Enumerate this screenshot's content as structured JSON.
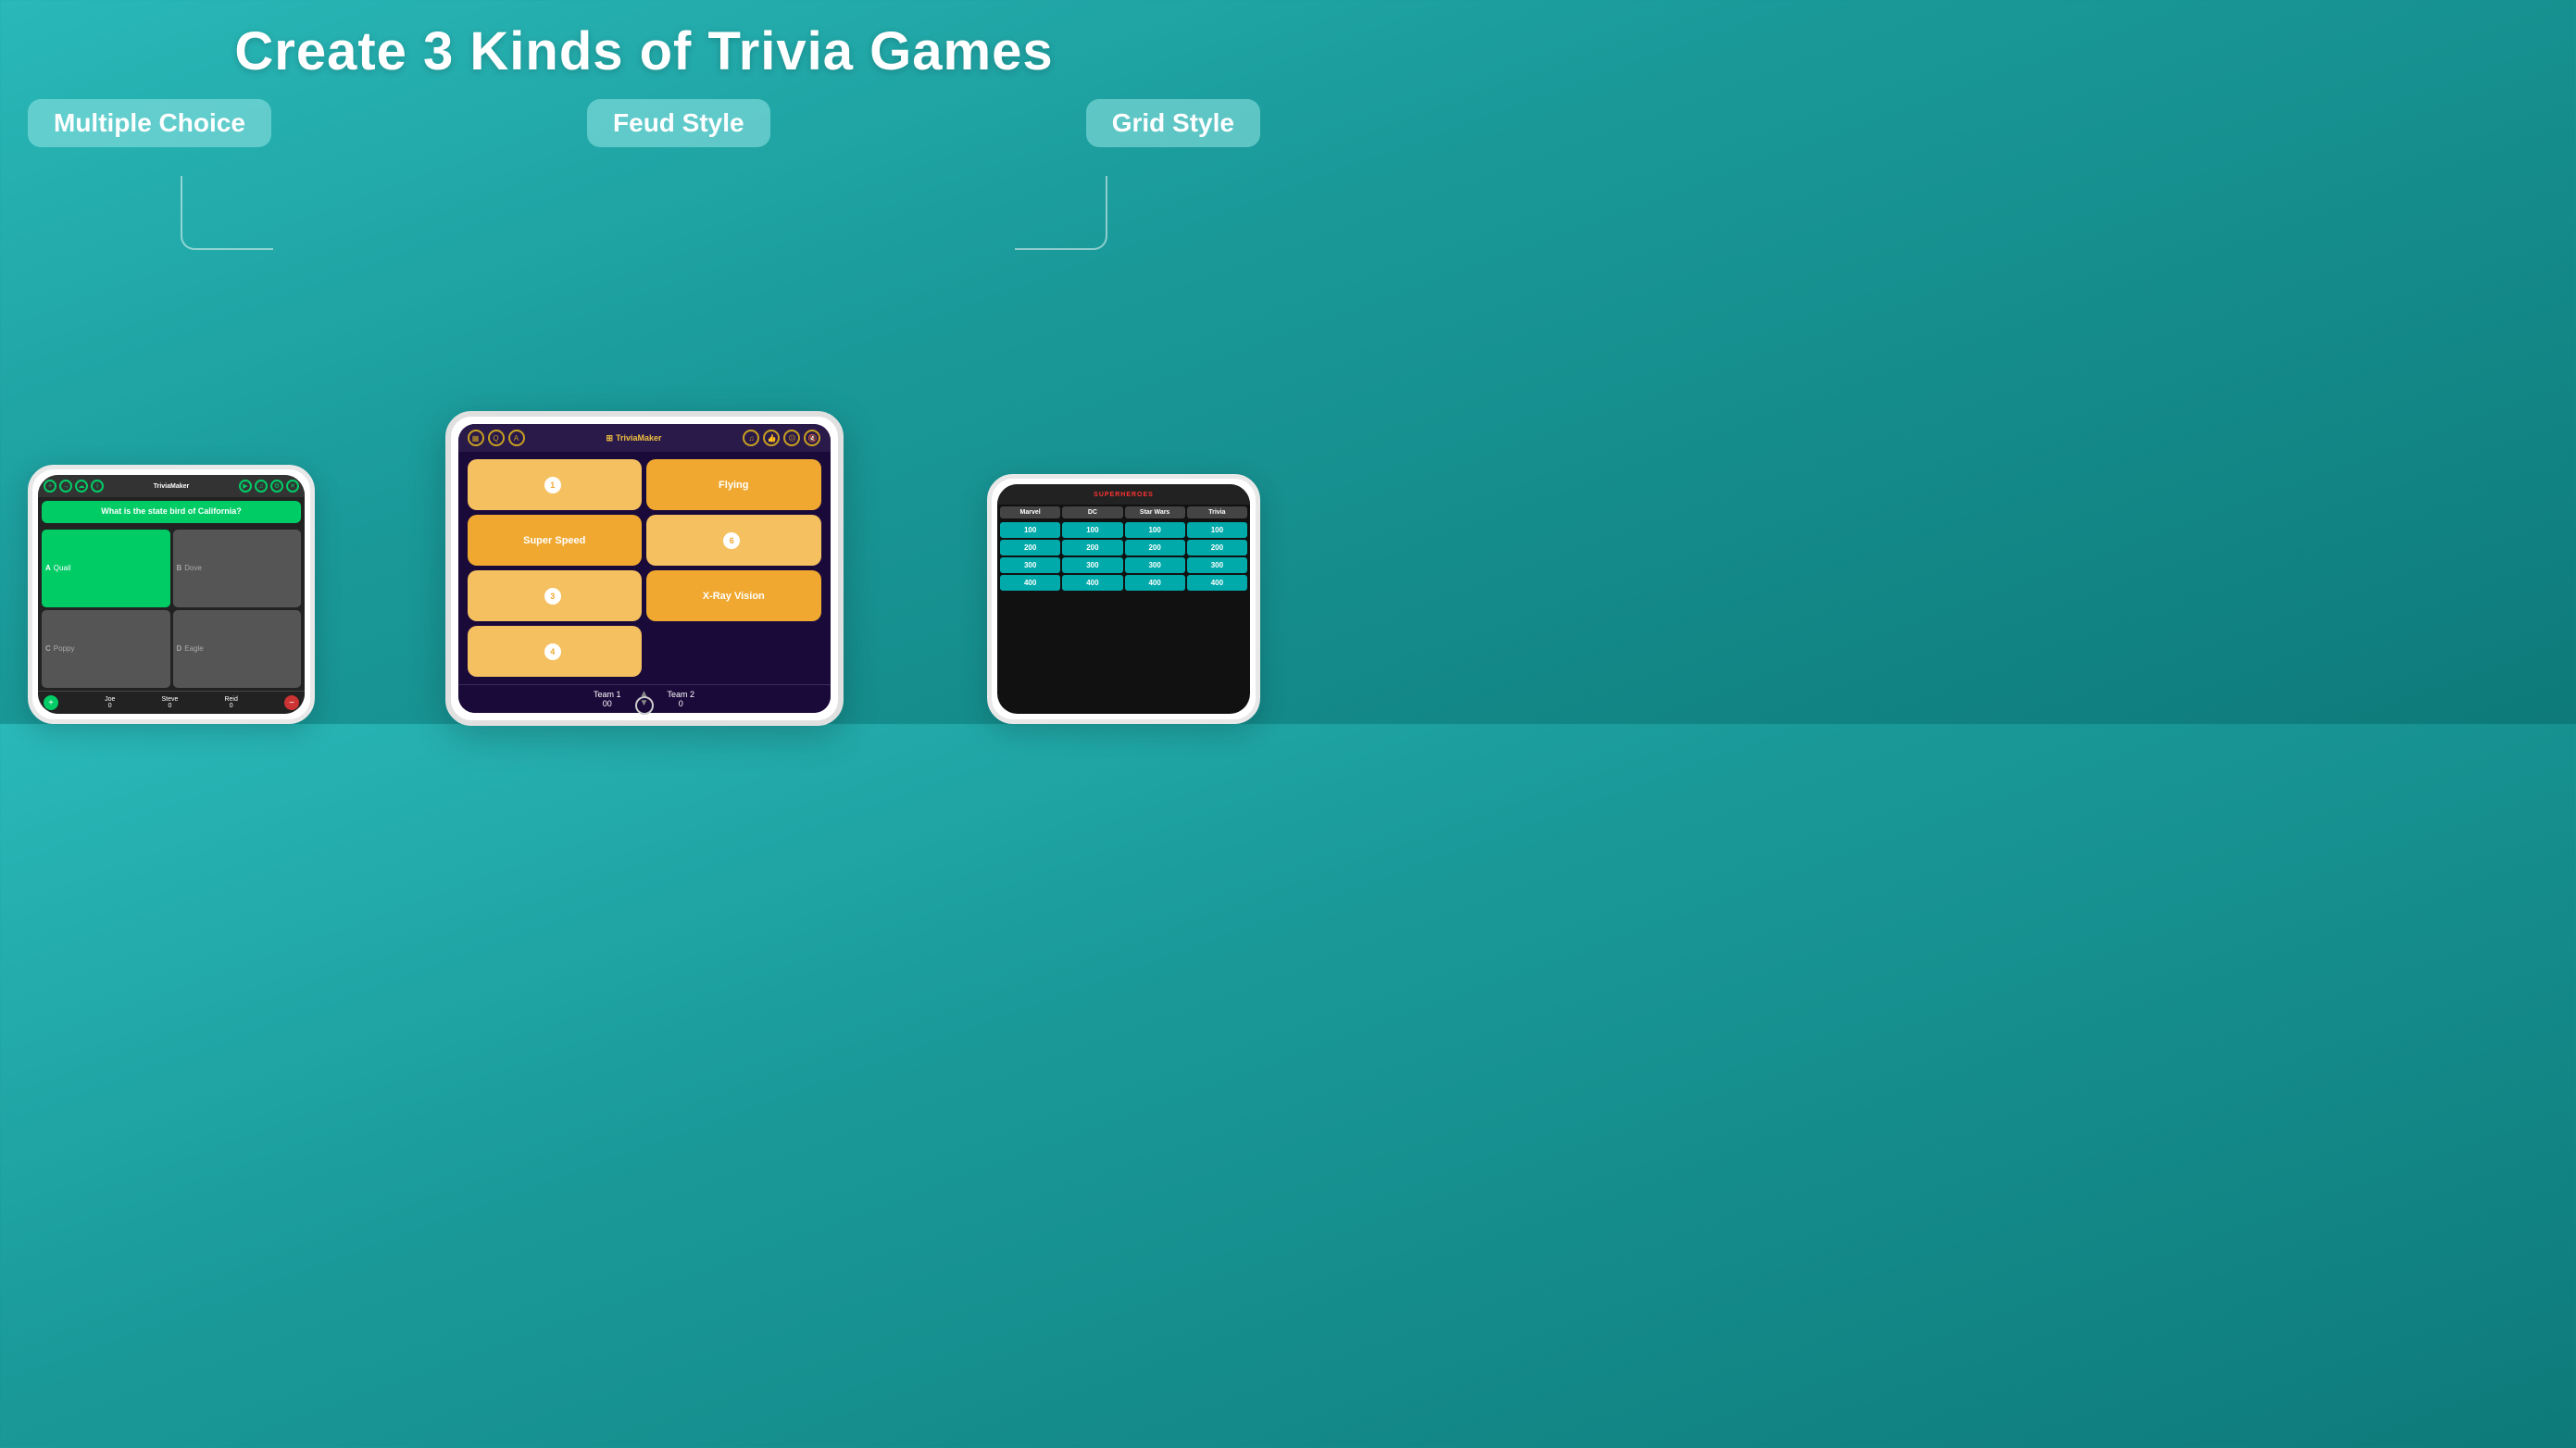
{
  "page": {
    "title": "Create 3 Kinds of Trivia Games",
    "bg_color": "#1fa8a8"
  },
  "labels": {
    "multiple_choice": "Multiple Choice",
    "feud_style": "Feud Style",
    "grid_style": "Grid Style"
  },
  "multiple_choice": {
    "app_name": "TriviaMaker",
    "question": "What is the state bird of California?",
    "answers": [
      {
        "letter": "A",
        "text": "Quail",
        "correct": true
      },
      {
        "letter": "B",
        "text": "Dove",
        "correct": false
      },
      {
        "letter": "C",
        "text": "Poppy",
        "correct": false
      },
      {
        "letter": "D",
        "text": "Eagle",
        "correct": false
      }
    ],
    "scores": [
      {
        "name": "Joe",
        "score": "0"
      },
      {
        "name": "Steve",
        "score": "0"
      },
      {
        "name": "Reid",
        "score": "0"
      }
    ]
  },
  "feud_style": {
    "app_name": "TriviaMaker",
    "answers": [
      {
        "type": "numbered",
        "number": "1",
        "text": ""
      },
      {
        "type": "text",
        "text": "Flying"
      },
      {
        "type": "text",
        "text": "Super Speed"
      },
      {
        "type": "numbered",
        "number": "6",
        "text": ""
      },
      {
        "type": "numbered",
        "number": "3",
        "text": ""
      },
      {
        "type": "text",
        "text": "X-Ray Vision"
      },
      {
        "type": "numbered",
        "number": "4",
        "text": ""
      }
    ],
    "teams": [
      {
        "name": "Team 1",
        "score": "00"
      },
      {
        "name": "Team 2",
        "score": "0"
      }
    ]
  },
  "grid_style": {
    "app_name": "SUPERHEROES",
    "columns": [
      "Marvel",
      "DC",
      "Star Wars",
      "Trivia"
    ],
    "rows": [
      [
        "100",
        "100",
        "100",
        "100"
      ],
      [
        "200",
        "200",
        "200",
        "200"
      ],
      [
        "300",
        "300",
        "300",
        "300"
      ],
      [
        "400",
        "400",
        "400",
        "400"
      ]
    ]
  }
}
